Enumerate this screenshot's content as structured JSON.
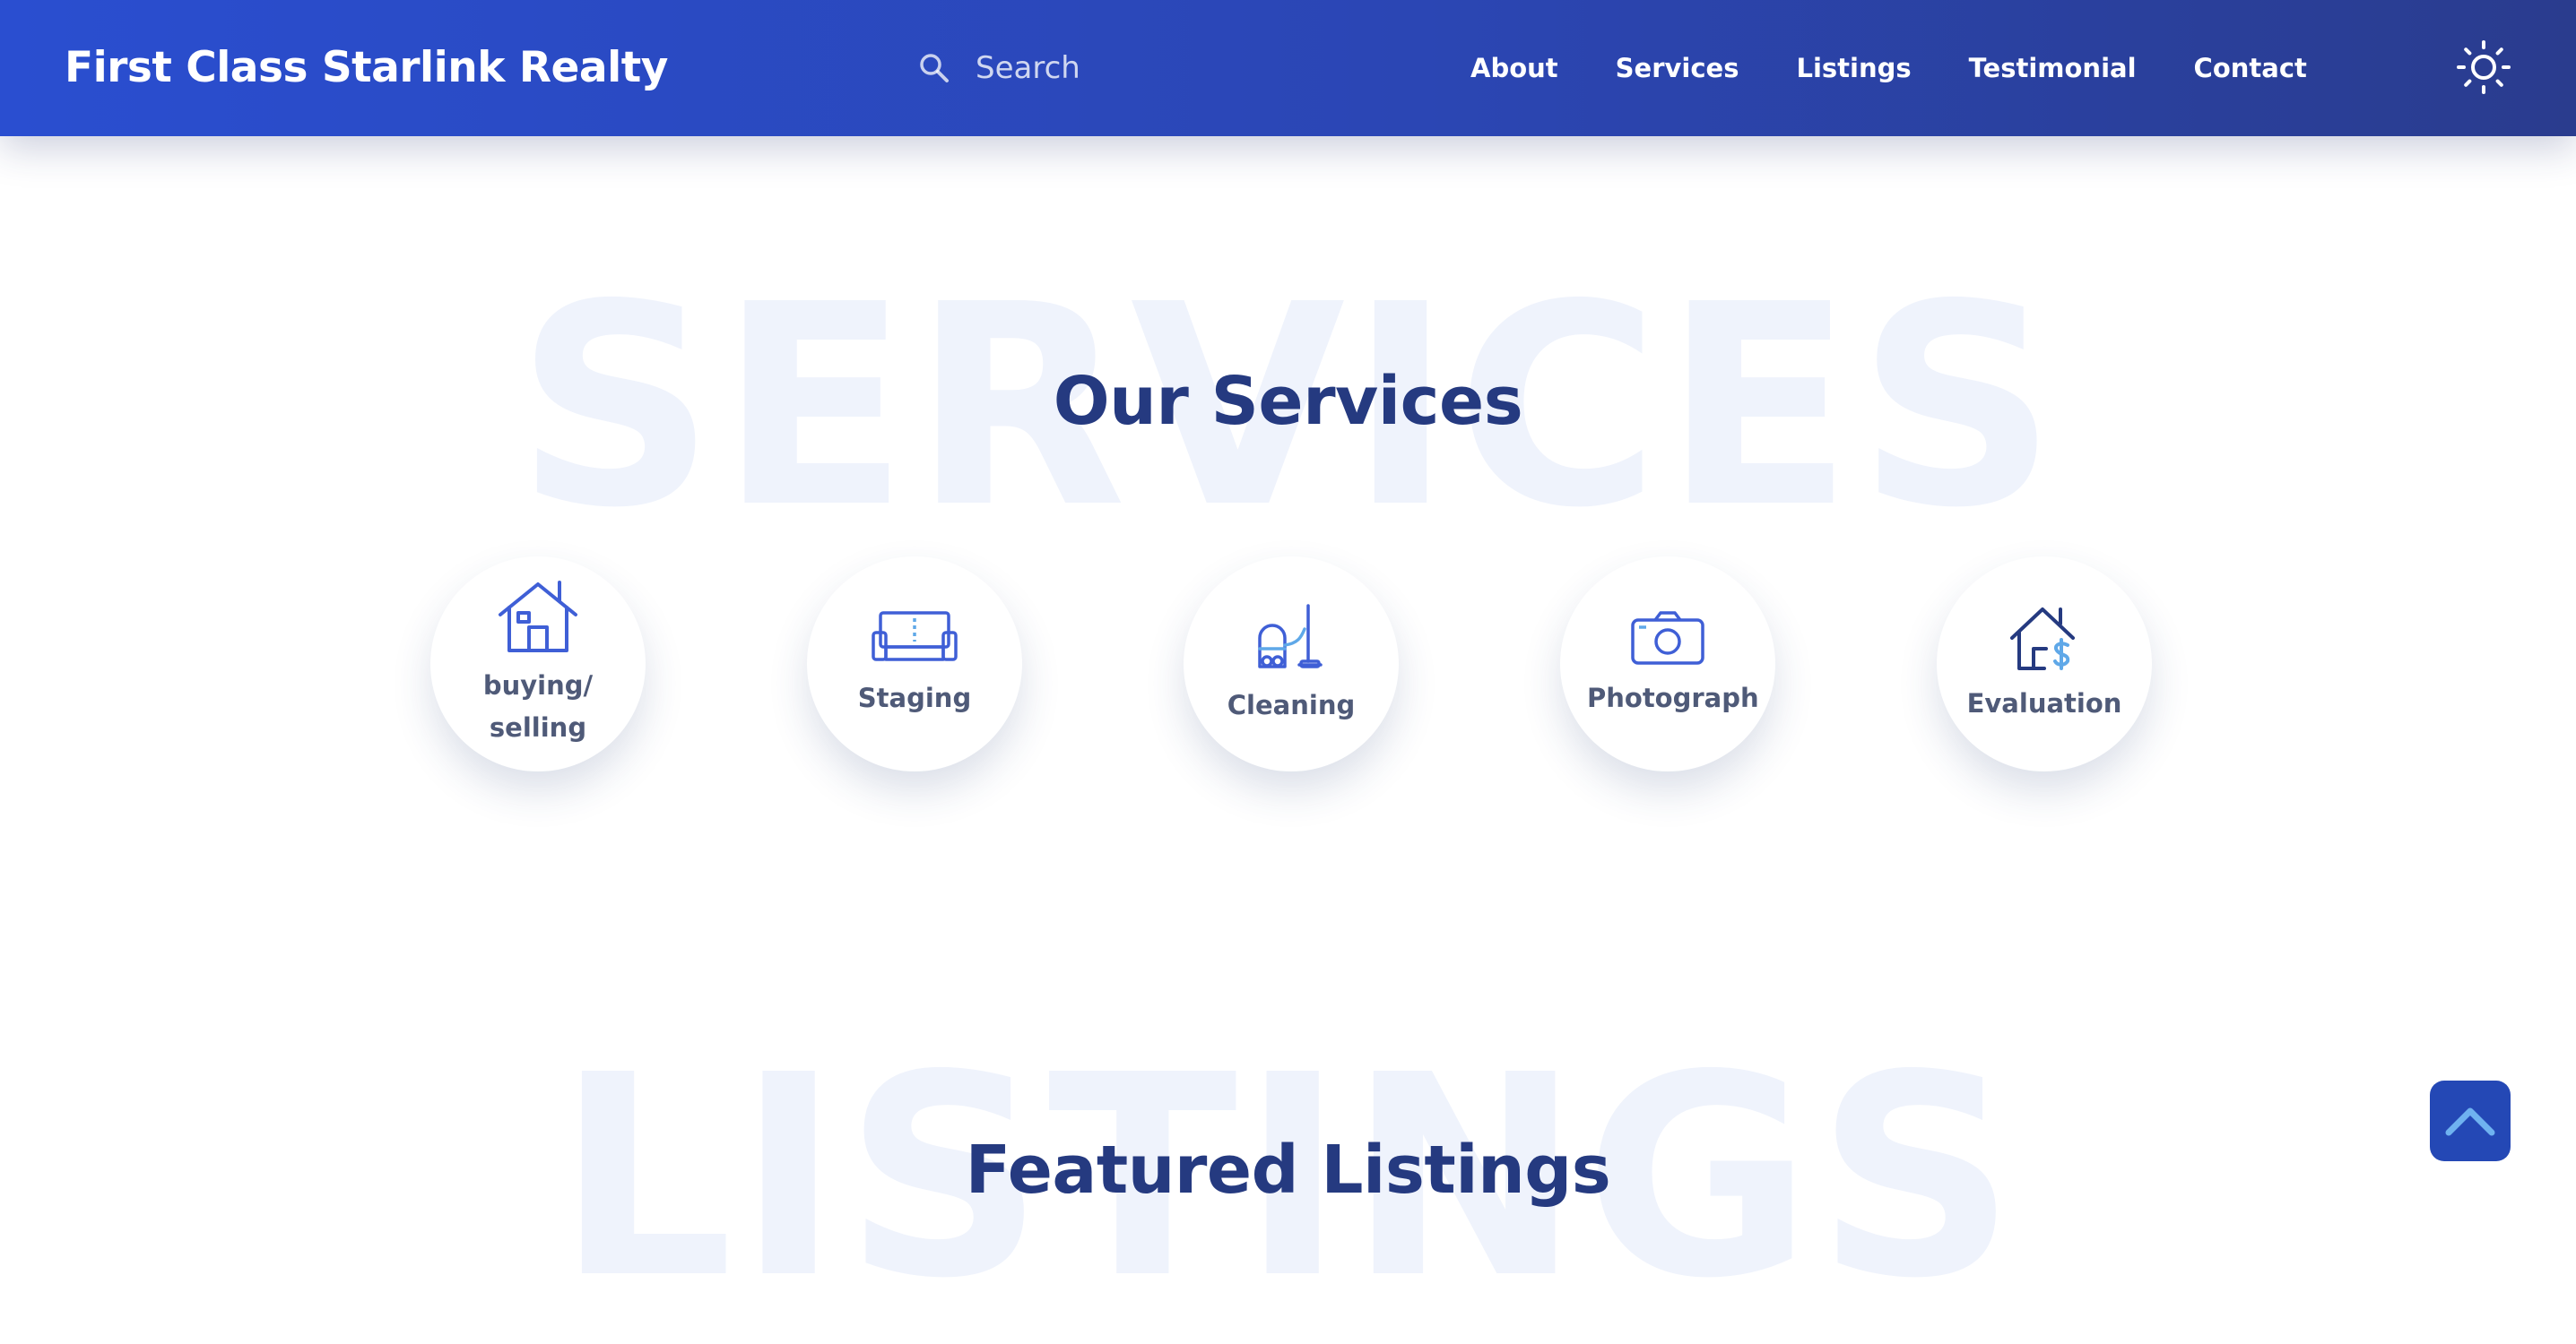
{
  "header": {
    "brand": "First Class Starlink Realty",
    "search_placeholder": "Search",
    "nav": [
      "About",
      "Services",
      "Listings",
      "Testimonial",
      "Contact"
    ],
    "theme_icon": "sun-icon",
    "search_icon": "search-icon"
  },
  "services_section": {
    "background_word": "SERVICES",
    "title": "Our Services",
    "items": [
      {
        "label": "buying/ selling",
        "icon": "house-icon"
      },
      {
        "label": "Staging",
        "icon": "couch-icon"
      },
      {
        "label": "Cleaning",
        "icon": "vacuum-icon"
      },
      {
        "label": "Photograph",
        "icon": "camera-icon"
      },
      {
        "label": "Evaluation",
        "icon": "house-dollar-icon"
      }
    ]
  },
  "listings_section": {
    "background_word": "LISTINGS",
    "title": "Featured Listings"
  },
  "back_to_top_icon": "chevron-up-icon",
  "colors": {
    "header_gradient_start": "#2a4ed0",
    "header_gradient_end": "#2a3c8e",
    "title": "#253a80",
    "watermark": "#eff3fc",
    "service_label": "#4f5a78",
    "icon_stroke": "#3f5fd6",
    "icon_accent": "#5fa8e8",
    "back_to_top": "#2448b5"
  }
}
